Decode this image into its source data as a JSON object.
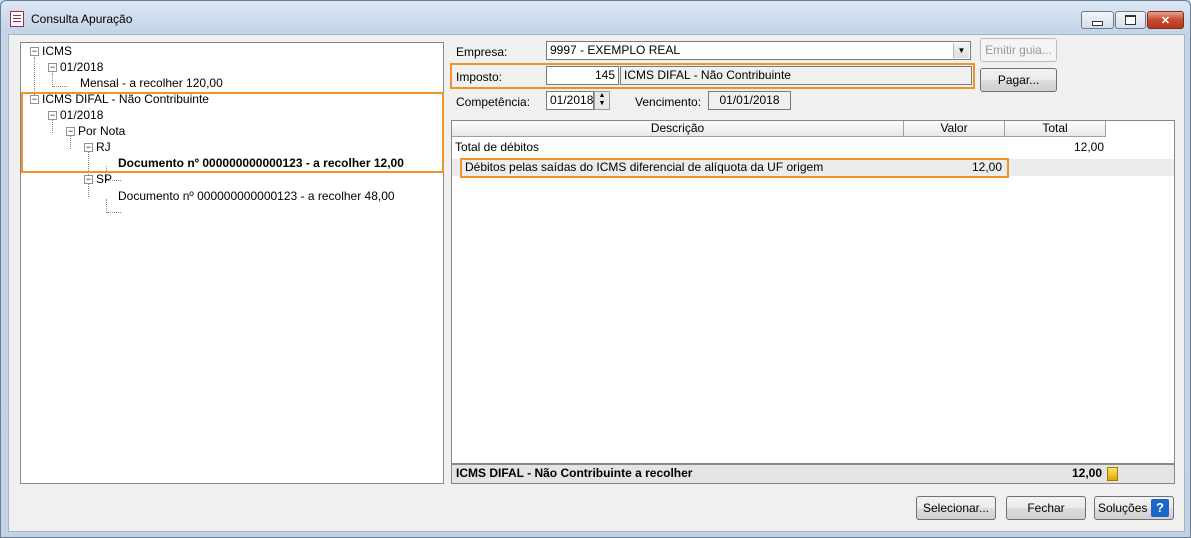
{
  "window": {
    "title": "Consulta Apuração",
    "minimize_icon": "minimize-icon",
    "maximize_icon": "maximize-icon",
    "close_glyph": "✕"
  },
  "tree": {
    "nodes": [
      {
        "label": "ICMS",
        "expander": "−"
      },
      {
        "label": "01/2018",
        "expander": "−"
      },
      {
        "label": "Mensal - a recolher 120,00"
      },
      {
        "label": "ICMS DIFAL - Não Contribuinte",
        "expander": "−"
      },
      {
        "label": "01/2018",
        "expander": "−"
      },
      {
        "label": "Por Nota",
        "expander": "−"
      },
      {
        "label": "RJ",
        "expander": "−"
      },
      {
        "label": "Documento nº 000000000000123 - a recolher 12,00"
      },
      {
        "label": "SP",
        "expander": "−"
      },
      {
        "label": "Documento nº 000000000000123 - a recolher 48,00"
      }
    ]
  },
  "form": {
    "empresa_label": "Empresa:",
    "empresa_value": "9997 - EXEMPLO REAL",
    "imposto_label": "Imposto:",
    "imposto_code": "145",
    "imposto_name": "ICMS DIFAL - Não Contribuinte",
    "competencia_label": "Competência:",
    "competencia_value": "01/2018",
    "vencimento_label": "Vencimento:",
    "vencimento_value": "01/01/2018",
    "emitir_guia_label": "Emitir guia...",
    "pagar_label": "Pagar..."
  },
  "grid": {
    "columns": [
      "Descrição",
      "Valor",
      "Total"
    ],
    "rows": [
      {
        "descricao": "Total de débitos",
        "valor": "",
        "total": "12,00"
      },
      {
        "descricao": "Débitos pelas saídas do ICMS diferencial de alíquota da UF origem",
        "valor": "12,00",
        "total": ""
      }
    ],
    "footer_label": "ICMS DIFAL - Não Contribuinte a recolher",
    "footer_value": "12,00"
  },
  "buttons": {
    "selecionar": "Selecionar...",
    "fechar": "Fechar",
    "solucoes": "Soluções",
    "help_glyph": "?"
  },
  "colors": {
    "highlight": "#f0932a"
  }
}
